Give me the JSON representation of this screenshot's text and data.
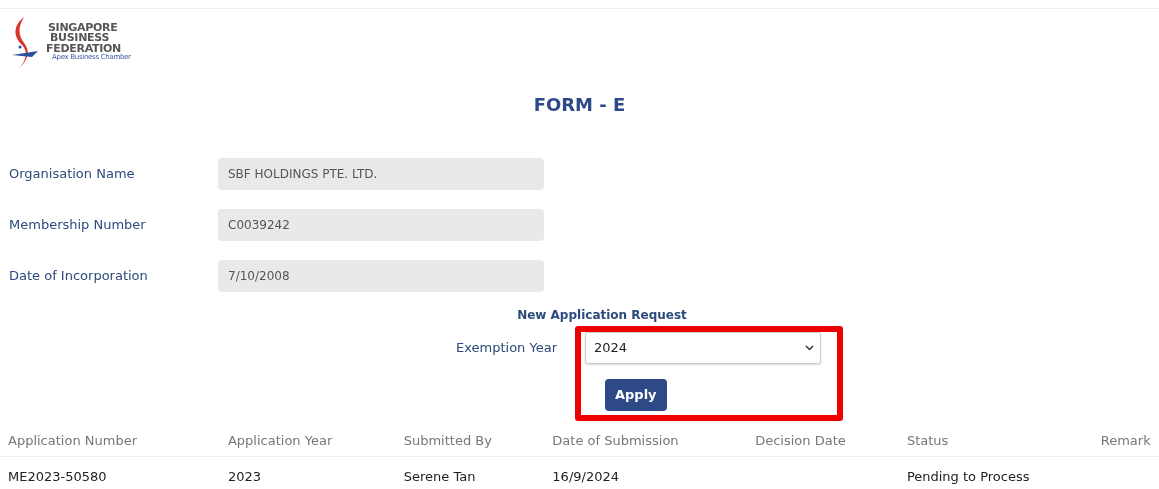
{
  "logo": {
    "lines": [
      "SINGAPORE",
      "BUSINESS",
      "FEDERATION"
    ],
    "tagline": "Apex Business Chamber"
  },
  "title": "FORM - E",
  "fields": [
    {
      "label": "Organisation Name",
      "value": "SBF HOLDINGS PTE. LTD."
    },
    {
      "label": "Membership Number",
      "value": "C0039242"
    },
    {
      "label": "Date of Incorporation",
      "value": "7/10/2008"
    }
  ],
  "request": {
    "heading": "New Application Request",
    "label": "Exemption Year",
    "value": "2024",
    "button": "Apply",
    "highlighted": true
  },
  "table": {
    "columns": [
      "Application Number",
      "Application Year",
      "Submitted By",
      "Date of Submission",
      "Decision Date",
      "Status",
      "Remark"
    ],
    "rows": [
      [
        "ME2023-50580",
        "2023",
        "Serene Tan",
        "16/9/2024",
        "",
        "Pending to Process",
        ""
      ]
    ]
  }
}
